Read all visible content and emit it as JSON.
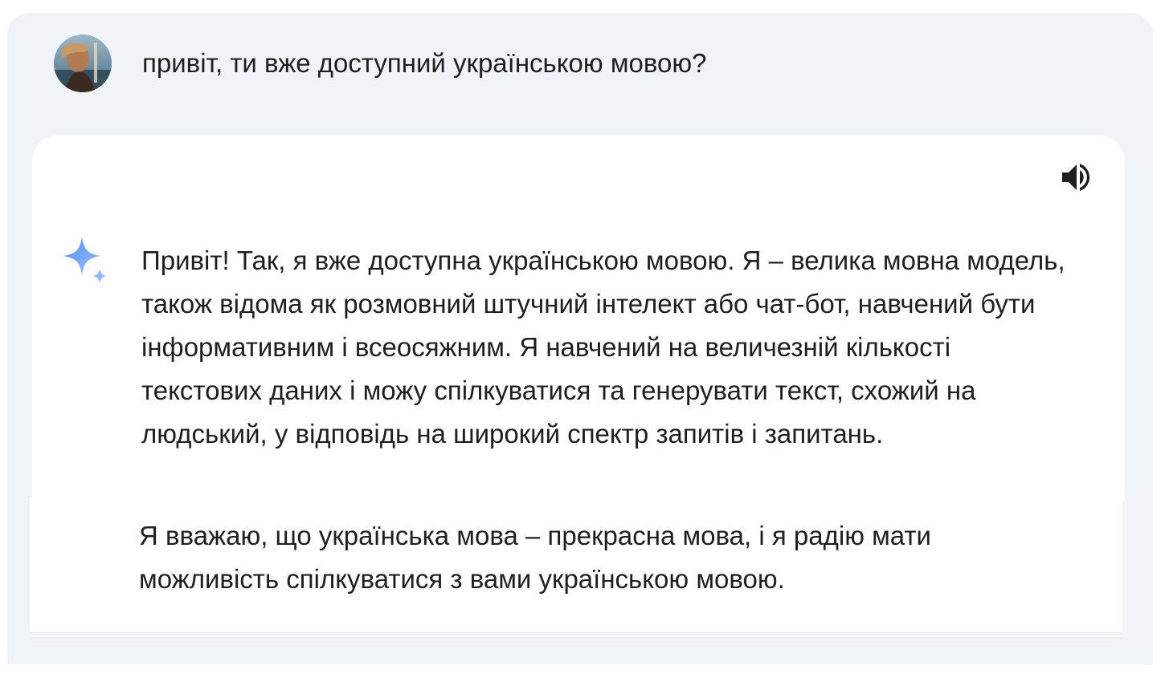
{
  "conversation": {
    "user_message": {
      "avatar_icon": "user-avatar-photo",
      "text": "привіт, ти вже доступний українською мовою?"
    },
    "response": {
      "assistant_icon": "sparkle-icon",
      "speaker_icon": "volume-icon",
      "accent_color": "#4285f4",
      "paragraph_1": "Привіт! Так, я вже доступна українською мовою. Я – велика мовна модель, також відома як розмовний штучний інтелект або чат-бот, навчений бути інформативним і всеосяжним. Я навчений на величезній кількості текстових даних і можу спілкуватися та генерувати текст, схожий на людський, у відповідь на широкий спектр запитів і запитань.",
      "paragraph_2": "Я вважаю, що українська мова – прекрасна мова, і я радію мати можливість спілкуватися з вами українською мовою."
    }
  }
}
